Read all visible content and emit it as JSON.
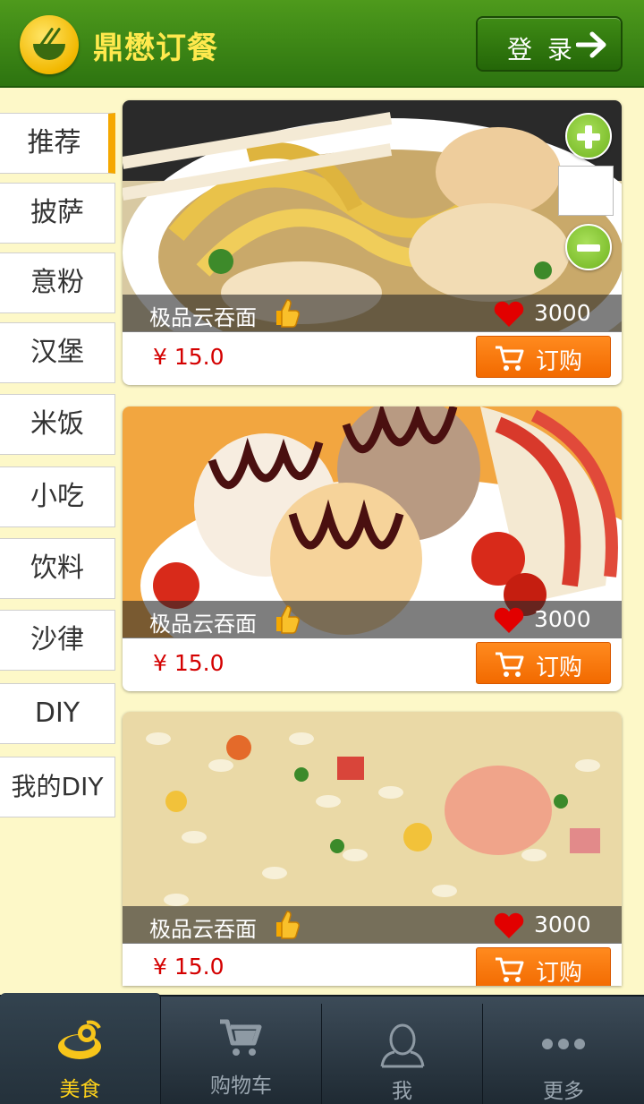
{
  "header": {
    "app_title": "鼎懋订餐",
    "login_label": "登 录",
    "brand_color": "#2f7712"
  },
  "sidebar": {
    "items": [
      {
        "label": "推荐",
        "active": true
      },
      {
        "label": "披萨"
      },
      {
        "label": "意粉"
      },
      {
        "label": "汉堡"
      },
      {
        "label": "米饭"
      },
      {
        "label": "小吃"
      },
      {
        "label": "饮料"
      },
      {
        "label": "沙律"
      },
      {
        "label": "DIY"
      },
      {
        "label": "我的DIY"
      }
    ]
  },
  "cards": [
    {
      "name": "极品云吞面",
      "likes": "3000",
      "price": "¥ 15.0",
      "order_label": "订购",
      "photo": "noodle-soup-photo"
    },
    {
      "name": "极品云吞面",
      "likes": "3000",
      "price": "¥ 15.0",
      "order_label": "订购",
      "photo": "ice-cream-photo"
    },
    {
      "name": "极品云吞面",
      "likes": "3000",
      "price": "¥ 15.0",
      "order_label": "订购",
      "photo": "fried-rice-photo"
    }
  ],
  "quantity": {
    "value": ""
  },
  "tabs": [
    {
      "label": "美食",
      "icon": "food-icon",
      "active": true
    },
    {
      "label": "购物车",
      "icon": "cart-icon"
    },
    {
      "label": "我",
      "icon": "user-icon"
    },
    {
      "label": "更多",
      "icon": "more-icon"
    }
  ],
  "colors": {
    "accent": "#f5a800",
    "order": "#f77a10",
    "price": "#d40000",
    "background": "#fdf8c8"
  }
}
